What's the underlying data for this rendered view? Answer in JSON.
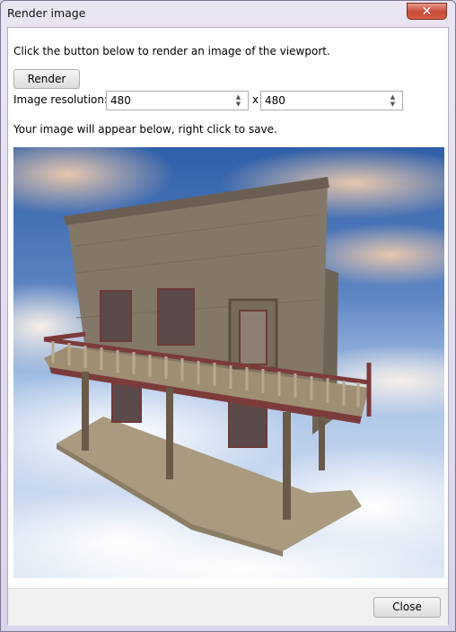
{
  "window": {
    "title": "Render image",
    "close_glyph": "✕"
  },
  "intro_text": "Click the button below to render an image of the viewport.",
  "render_label": "Render",
  "resolution": {
    "label": "Image resolution:",
    "width": "480",
    "separator": "x",
    "height": "480"
  },
  "note_text": "Your image will appear below, right click to save.",
  "close_label": "Close",
  "colors": {
    "sky": "#3f6fb3",
    "clouds": "#f2ece6",
    "wood": "#7b6f60",
    "trim": "#7c3b3b",
    "porch": "#a99a80"
  }
}
